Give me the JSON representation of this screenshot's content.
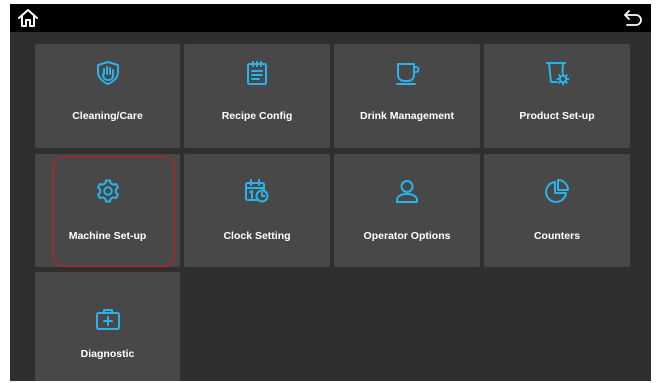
{
  "colors": {
    "icon_accent": "#29b3ea",
    "tile_bg": "#484848",
    "screen_bg": "#2f2f2f",
    "topbar_bg": "#000000",
    "highlight": "#d21a1a",
    "label_text": "#ffffff"
  },
  "topbar": {
    "home_icon": "home-icon",
    "back_icon": "back-arrow-icon"
  },
  "tiles": [
    {
      "label": "Cleaning/Care",
      "icon": "cleaning-hand-icon"
    },
    {
      "label": "Recipe Config",
      "icon": "clipboard-icon"
    },
    {
      "label": "Drink Management",
      "icon": "cup-icon"
    },
    {
      "label": "Product Set-up",
      "icon": "container-gear-icon"
    },
    {
      "label": "Machine Set-up",
      "icon": "gear-icon"
    },
    {
      "label": "Clock Setting",
      "icon": "calendar-clock-icon"
    },
    {
      "label": "Operator Options",
      "icon": "user-icon"
    },
    {
      "label": "Counters",
      "icon": "pie-chart-icon"
    },
    {
      "label": "Diagnostic",
      "icon": "first-aid-kit-icon"
    }
  ]
}
